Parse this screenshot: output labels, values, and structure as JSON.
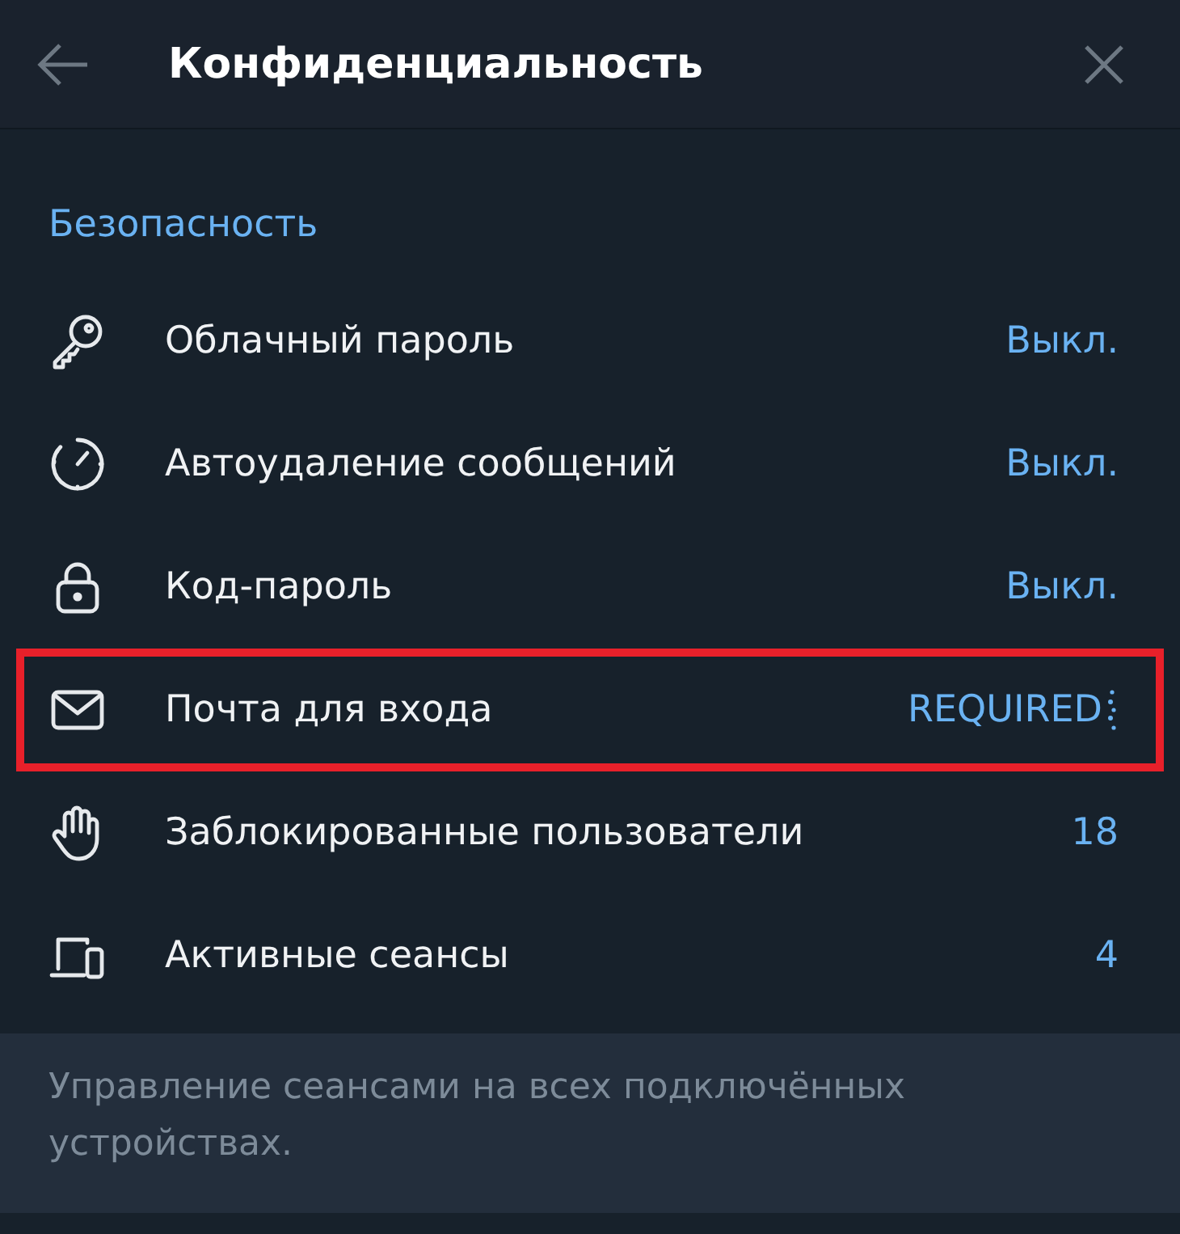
{
  "window": {
    "title": "Конфиденциальность"
  },
  "section": {
    "title": "Безопасность"
  },
  "items": [
    {
      "kind": "key",
      "label": "Облачный пароль",
      "value": "Выкл.",
      "highlighted": false
    },
    {
      "kind": "timer",
      "label": "Автоудаление сообщений",
      "value": "Выкл.",
      "highlighted": false
    },
    {
      "kind": "lock",
      "label": "Код-пароль",
      "value": "Выкл.",
      "highlighted": false
    },
    {
      "kind": "mail",
      "label": "Почта для входа",
      "value": "REQUIRED",
      "highlighted": true
    },
    {
      "kind": "hand",
      "label": "Заблокированные пользователи",
      "value": "18",
      "highlighted": false
    },
    {
      "kind": "devices",
      "label": "Активные сеансы",
      "value": "4",
      "highlighted": false
    }
  ],
  "footer_note": "Управление сеансами на всех подключённых устройствах."
}
